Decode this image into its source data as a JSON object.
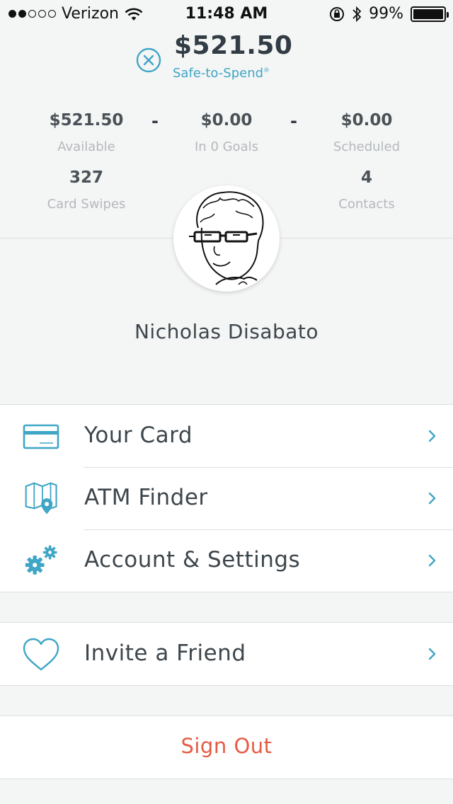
{
  "status_bar": {
    "carrier": "Verizon",
    "time": "11:48 AM",
    "battery": "99%",
    "signal_bars": 2,
    "battery_level": 0.99
  },
  "header": {
    "amount": "$521.50",
    "label": "Safe-to-Spend",
    "label_mark": "®"
  },
  "stats": {
    "available": {
      "value": "$521.50",
      "label": "Available"
    },
    "goals": {
      "value": "$0.00",
      "label": "In 0 Goals"
    },
    "scheduled": {
      "value": "$0.00",
      "label": "Scheduled"
    },
    "separator": "-",
    "card_swipes": {
      "value": "327",
      "label": "Card Swipes"
    },
    "contacts": {
      "value": "4",
      "label": "Contacts"
    }
  },
  "profile": {
    "name": "Nicholas Disabato"
  },
  "menu": {
    "items": [
      {
        "label": "Your Card",
        "icon": "credit-card-icon"
      },
      {
        "label": "ATM Finder",
        "icon": "map-pin-icon"
      },
      {
        "label": "Account & Settings",
        "icon": "gears-icon"
      }
    ],
    "invite": {
      "label": "Invite a Friend",
      "icon": "heart-icon"
    }
  },
  "sign_out": {
    "label": "Sign Out"
  },
  "colors": {
    "accent": "#3fa6c6",
    "danger": "#e45c44",
    "background": "#f4f5f5",
    "text_dark": "#323c44",
    "text_muted": "#b4b9bc"
  }
}
